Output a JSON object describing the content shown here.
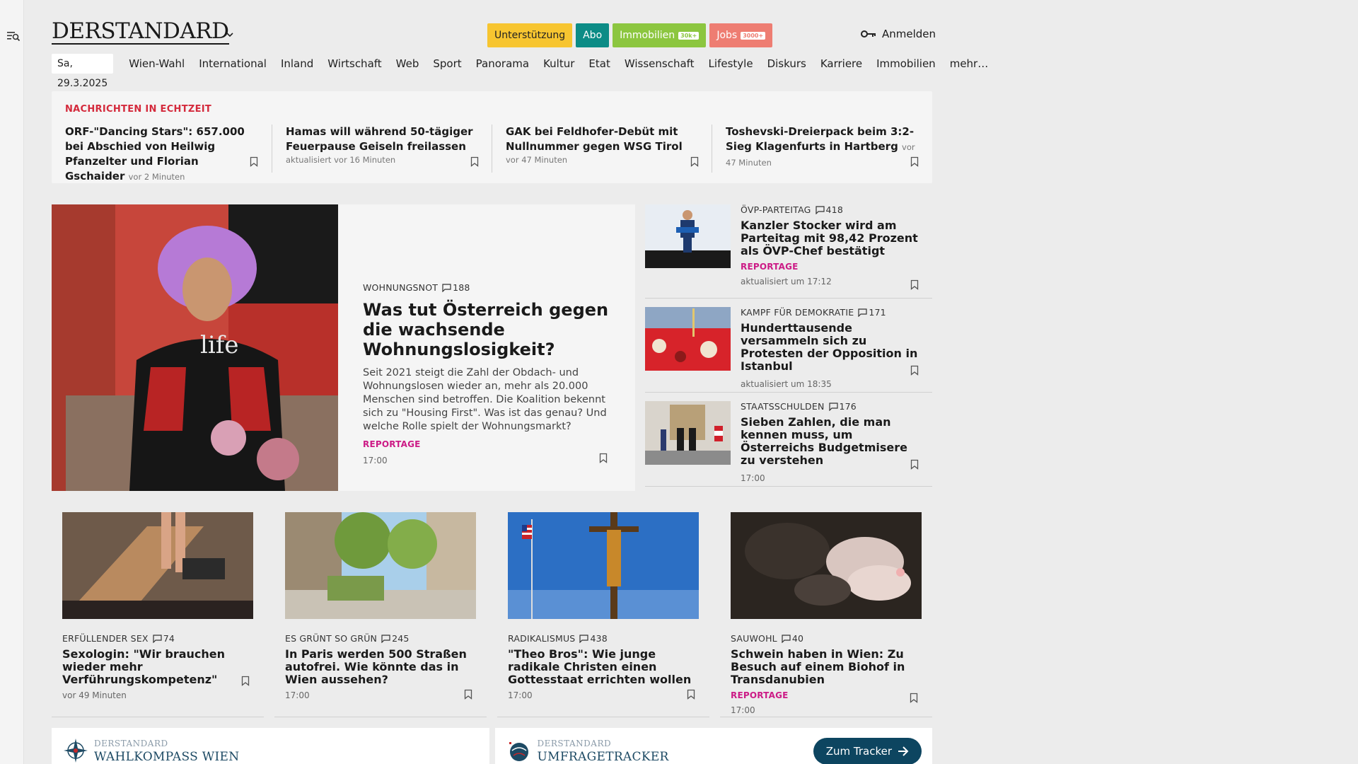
{
  "brand": {
    "logo": "DERSTANDARD"
  },
  "header": {
    "pills": [
      {
        "label": "Unterstützung",
        "badge": ""
      },
      {
        "label": "Abo",
        "badge": ""
      },
      {
        "label": "Immobilien",
        "badge": "30k+"
      },
      {
        "label": "Jobs",
        "badge": "3000+"
      }
    ],
    "login": "Anmelden"
  },
  "nav": {
    "date": "Sa, 29.3.2025",
    "items": [
      "Wien-Wahl",
      "International",
      "Inland",
      "Wirtschaft",
      "Web",
      "Sport",
      "Panorama",
      "Kultur",
      "Etat",
      "Wissenschaft",
      "Lifestyle",
      "Diskurs",
      "Karriere",
      "Immobilien",
      "mehr…"
    ]
  },
  "live": {
    "title": "NACHRICHTEN IN ECHTZEIT",
    "items": [
      {
        "headline": "ORF-\"Dancing Stars\": 657.000 bei Abschied von Heilwig Pfanzelter und Florian Gschaider",
        "time": "vor 2 Minuten"
      },
      {
        "headline": "Hamas will während 50-tägiger Feuerpause Geiseln freilassen",
        "time": "aktualisiert vor 16 Minuten"
      },
      {
        "headline": "GAK bei Feldhofer-Debüt mit Nullnummer gegen WSG Tirol",
        "time": "vor 47 Minuten"
      },
      {
        "headline": "Toshevski-Dreierpack beim 3:2-Sieg Klagenfurts in Hartberg",
        "time": "vor 47 Minuten"
      }
    ]
  },
  "hero": {
    "kicker": "WOHNUNGSNOT",
    "comments": "188",
    "headline": "Was tut Österreich gegen die wachsende Wohnungslosigkeit?",
    "teaser": "Seit 2021 steigt die Zahl der Obdach- und Wohnungslosen wieder an, mehr als 20.000 Menschen sind betroffen. Die Koalition bekennt sich zu \"Housing First\". Was ist das genau? Und welche Rolle spielt der Wohnungsmarkt?",
    "tag": "REPORTAGE",
    "time": "17:00",
    "image_text": "life"
  },
  "side": [
    {
      "kicker": "ÖVP-PARTEITAG",
      "comments": "418",
      "headline": "Kanzler Stocker wird am Parteitag mit 98,42 Prozent als ÖVP-Chef bestätigt",
      "tag": "REPORTAGE",
      "time": "aktualisiert um 17:12"
    },
    {
      "kicker": "KAMPF FÜR DEMOKRATIE",
      "comments": "171",
      "headline": "Hunderttausende versammeln sich zu Protesten der Opposition in Istanbul",
      "tag": "",
      "time": "aktualisiert um 18:35"
    },
    {
      "kicker": "STAATSSCHULDEN",
      "comments": "176",
      "headline": "Sieben Zahlen, die man kennen muss, um Österreichs Budgetmisere zu verstehen",
      "tag": "",
      "time": "17:00"
    }
  ],
  "cards": [
    {
      "kicker": "ERFÜLLENDER SEX",
      "comments": "74",
      "headline": "Sexologin: \"Wir brauchen wieder mehr Verführungskompetenz\"",
      "tag": "",
      "time": "vor 49 Minuten"
    },
    {
      "kicker": "ES GRÜNT SO GRÜN",
      "comments": "245",
      "headline": "In Paris werden 500 Straßen autofrei. Wie könnte das in Wien aussehen?",
      "tag": "",
      "time": "17:00"
    },
    {
      "kicker": "RADIKALISMUS",
      "comments": "438",
      "headline": "\"Theo Bros\": Wie junge radikale Christen einen Gottesstaat errichten wollen",
      "tag": "",
      "time": "17:00"
    },
    {
      "kicker": "SAUWOHL",
      "comments": "40",
      "headline": "Schwein haben in Wien: Zu Besuch auf einem Biohof in Transdanubien",
      "tag": "REPORTAGE",
      "time": "17:00"
    }
  ],
  "banners": [
    {
      "brand": "DERSTANDARD",
      "title": "WAHLKOMPASS WIEN",
      "button": ""
    },
    {
      "brand": "DERSTANDARD",
      "title": "UMFRAGETRACKER",
      "button": "Zum Tracker"
    }
  ],
  "colors": {
    "live_title": "#d42a3c",
    "reportage": "#cc1b86",
    "abo": "#0c8c86",
    "support": "#f7c530",
    "immobilien": "#8cc63f",
    "jobs": "#ee7d72",
    "tracker_button": "#0d4560"
  },
  "icons": {
    "left_bar": "search-list-icon",
    "login": "key-icon",
    "bookmark": "bookmark-icon",
    "comment": "comment-icon",
    "dropdown": "chevron-down-icon",
    "button_arrow": "arrow-right-icon"
  }
}
